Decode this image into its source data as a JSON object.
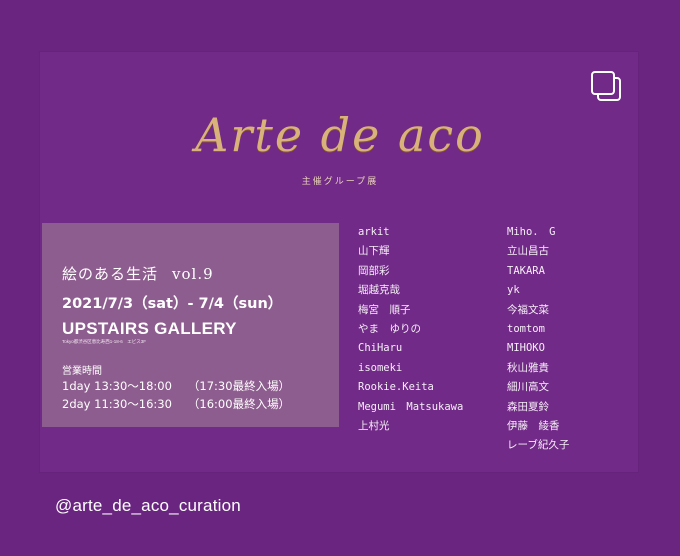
{
  "poster": {
    "logo": "Arte de aco",
    "subtitle": "主催グループ展",
    "event_title": "絵のある生活",
    "event_vol": "vol.9",
    "dates": "2021/7/3（sat）- 7/4（sun）",
    "venue": "UPSTAIRS GALLERY",
    "venue_address": "Tokyo都渋谷区恵比寿西1-18-6　エビス3F",
    "hours_label": "営業時間",
    "hours": [
      {
        "day": "1day 13:30〜18:00",
        "last": "（17:30最終入場）"
      },
      {
        "day": "2day 11:30〜16:30",
        "last": "（16:00最終入場）"
      }
    ],
    "artists_left": [
      "arkit",
      "山下輝",
      "岡部彩",
      "堀越克哉",
      "梅宮　順子",
      "やま　ゆりの",
      "ChiHaru",
      "isomeki",
      "Rookie.Keita",
      "Megumi　Matsukawa",
      "上村光"
    ],
    "artists_right": [
      "Miho.　G",
      "立山昌古",
      "TAKARA",
      "yk",
      "今福文菜",
      "tomtom",
      "MIHOKO",
      "秋山雅貴",
      "細川高文",
      "森田夏鈴",
      "伊藤　綾香",
      "レーブ紀久子"
    ]
  },
  "caption": {
    "handle": "@arte_de_aco_curation"
  },
  "icons": {
    "multi_post": "multiple-images-icon"
  },
  "colors": {
    "background": "#6a2580",
    "card": "#722a88",
    "info_box": "#8e5d8f",
    "gold": "#d8b27a"
  }
}
